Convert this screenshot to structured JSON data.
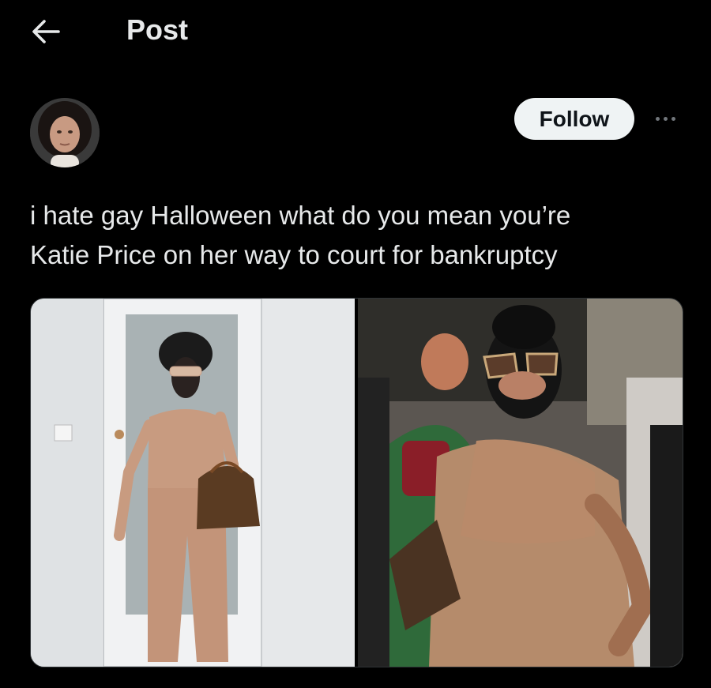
{
  "header": {
    "title": "Post",
    "back_icon": "arrow-left-icon"
  },
  "author": {
    "avatar_icon": "avatar"
  },
  "actions": {
    "follow_label": "Follow",
    "more_icon": "more-horizontal-icon"
  },
  "post": {
    "text_line1": "i hate gay Halloween what do you mean you’re",
    "text_line2": "Katie Price on her way to court for bankruptcy"
  },
  "colors": {
    "background": "#000000",
    "text": "#e7e9ea",
    "follow_bg": "#eff3f4",
    "follow_text": "#0f1419",
    "muted": "#71767b"
  }
}
